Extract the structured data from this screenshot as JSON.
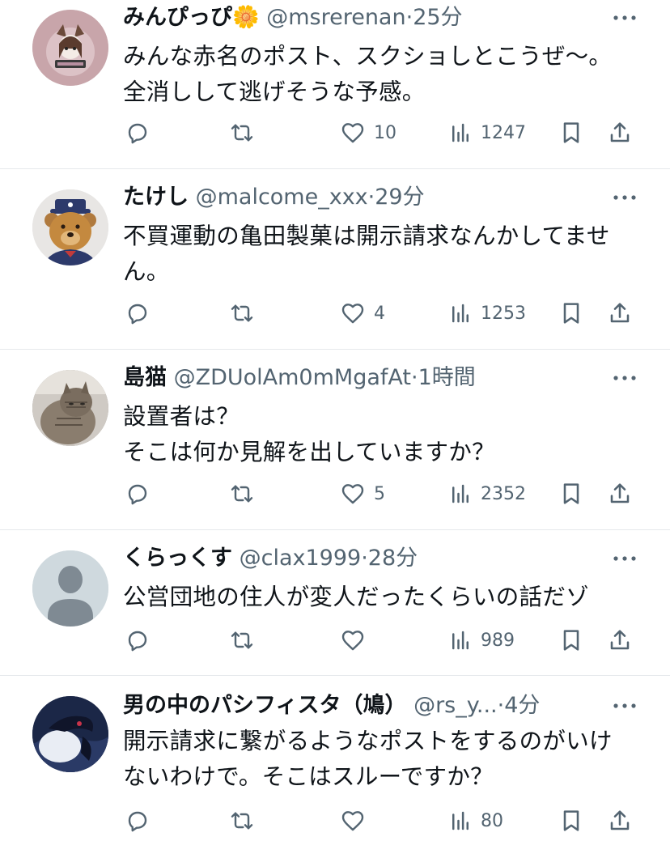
{
  "posts": [
    {
      "name": "みんぴっぴ",
      "badge": "🌼",
      "handle": "@msrerenan",
      "sep": "·",
      "time": "25分",
      "lines": [
        "みんな赤名のポスト、スクショしとこうぜ〜。",
        "全消しして逃げそうな予感。"
      ],
      "likes": "10",
      "views": "1247",
      "avatar_icon": "illustrated-character-avatar"
    },
    {
      "name": "たけし",
      "badge": "",
      "handle": "@malcome_xxx",
      "sep": "·",
      "time": "29分",
      "lines": [
        "不買運動の亀田製菓は開示請求なんかしてませ",
        "ん。"
      ],
      "likes": "4",
      "views": "1253",
      "avatar_icon": "teddy-bear-avatar"
    },
    {
      "name": "島猫",
      "badge": "",
      "handle": "@ZDUolAm0mMgafAt",
      "sep": "·",
      "time": "1時間",
      "lines": [
        "設置者は？",
        "そこは何か見解を出していますか？"
      ],
      "likes": "5",
      "views": "2352",
      "avatar_icon": "cat-photo-avatar"
    },
    {
      "name": "くらっくす",
      "badge": "",
      "handle": "@clax1999",
      "sep": "·",
      "time": "28分",
      "lines": [
        "公営団地の住人が変人だったくらいの話だゾ"
      ],
      "likes": "",
      "views": "989",
      "avatar_icon": "default-user-avatar"
    },
    {
      "name": "男の中のパシフィスタ（鳩）",
      "badge": "",
      "handle": "@rs_y...",
      "sep": "·",
      "time": "4分",
      "lines": [
        "開示請求に繋がるようなポストをするのがいけ",
        "ないわけで。そこはスルーですか？"
      ],
      "likes": "",
      "views": "80",
      "avatar_icon": "pigeon-avatar"
    }
  ],
  "colors": {
    "text": "#0f1419",
    "muted": "#536471",
    "divider": "#e6e9ec"
  }
}
